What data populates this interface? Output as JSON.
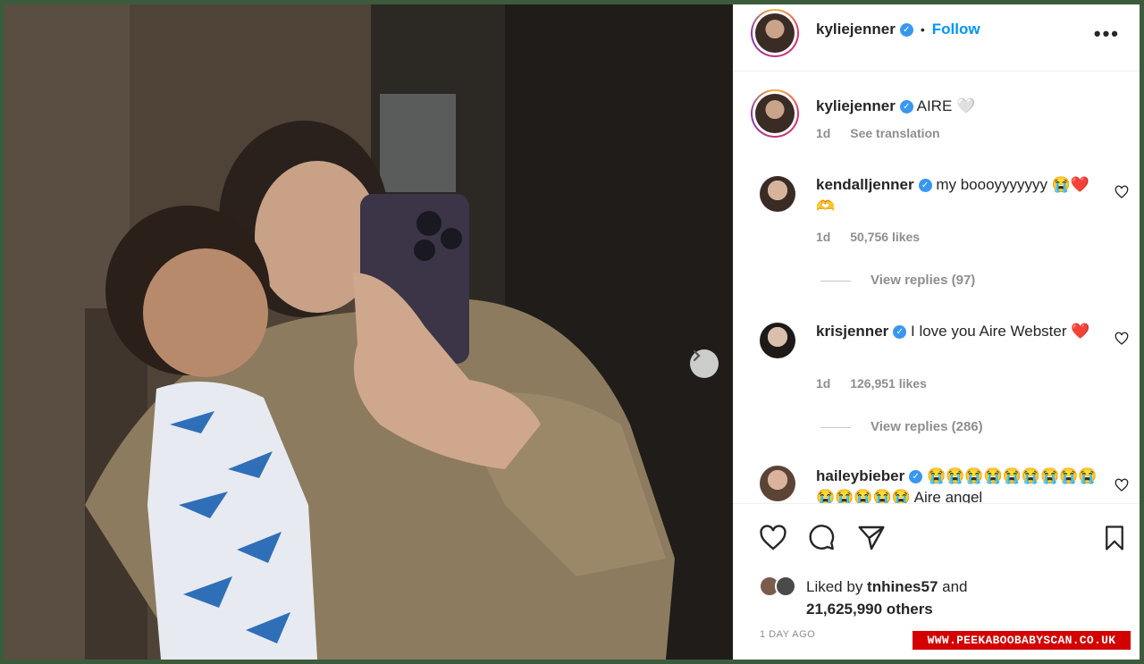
{
  "post": {
    "author": "kyliejenner",
    "follow_label": "Follow",
    "separator": "•",
    "more_label": "•••"
  },
  "caption": {
    "username": "kyliejenner",
    "text": "AIRE 🤍",
    "time": "1d",
    "translate_label": "See translation"
  },
  "comments": [
    {
      "username": "kendalljenner",
      "text": "my boooyyyyyyy 😭❤️🫶",
      "time": "1d",
      "likes": "50,756 likes",
      "replies": "View replies (97)"
    },
    {
      "username": "krisjenner",
      "text": "I love you Aire Webster ❤️",
      "time": "1d",
      "likes": "126,951 likes",
      "replies": "View replies (286)"
    },
    {
      "username": "haileybieber",
      "text": "😭😭😭😭😭😭😭😭😭😭😭😭😭😭 Aire angel"
    }
  ],
  "likes": {
    "prefix": "Liked by ",
    "user": "tnhines57",
    "suffix": " and",
    "count": "21,625,990 others"
  },
  "posted_ago": "1 DAY AGO",
  "watermark": "WWW.PEEKABOOBABYSCAN.CO.UK",
  "icons": [
    "heart-icon",
    "comment-icon",
    "share-icon",
    "bookmark-icon",
    "verified-icon",
    "chevron-right-icon",
    "more-icon"
  ],
  "colors": {
    "follow": "#0095f6",
    "verified": "#3897f0",
    "muted": "#8e8e8e",
    "text": "#262626",
    "watermark_bg": "#d40000",
    "border": "#3c5a3c"
  }
}
